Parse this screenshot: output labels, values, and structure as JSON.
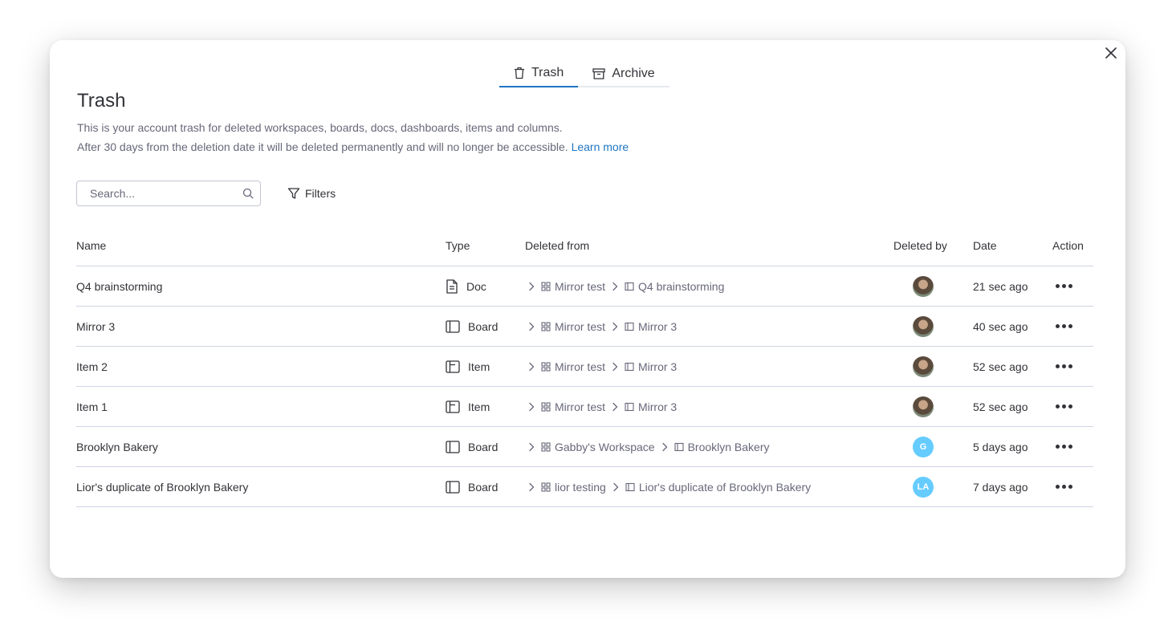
{
  "tabs": [
    {
      "label": "Trash",
      "icon": "trash-icon",
      "active": true
    },
    {
      "label": "Archive",
      "icon": "archive-icon",
      "active": false
    }
  ],
  "title": "Trash",
  "description": {
    "line1": "This is your account trash for deleted workspaces, boards, docs, dashboards, items and columns.",
    "line2": "After 30 days from the deletion date it will be deleted permanently and will no longer be accessible.",
    "link": "Learn more"
  },
  "search": {
    "placeholder": "Search...",
    "value": ""
  },
  "filters_label": "Filters",
  "columns": {
    "name": "Name",
    "type": "Type",
    "deleted_from": "Deleted from",
    "deleted_by": "Deleted by",
    "date": "Date",
    "action": "Action"
  },
  "rows": [
    {
      "name": "Q4 brainstorming",
      "type": "Doc",
      "type_icon": "doc-icon",
      "workspace": "Mirror test",
      "board": "Q4 brainstorming",
      "avatar": "photo",
      "initials": "",
      "date": "21 sec ago"
    },
    {
      "name": "Mirror 3",
      "type": "Board",
      "type_icon": "board-icon",
      "workspace": "Mirror test",
      "board": "Mirror 3",
      "avatar": "photo",
      "initials": "",
      "date": "40 sec ago"
    },
    {
      "name": "Item 2",
      "type": "Item",
      "type_icon": "item-icon",
      "workspace": "Mirror test",
      "board": "Mirror 3",
      "avatar": "photo",
      "initials": "",
      "date": "52 sec ago"
    },
    {
      "name": "Item 1",
      "type": "Item",
      "type_icon": "item-icon",
      "workspace": "Mirror test",
      "board": "Mirror 3",
      "avatar": "photo",
      "initials": "",
      "date": "52 sec ago"
    },
    {
      "name": "Brooklyn Bakery",
      "type": "Board",
      "type_icon": "board-icon",
      "workspace": "Gabby's Workspace",
      "board": "Brooklyn Bakery",
      "avatar": "initials",
      "initials": "G",
      "date": "5 days ago"
    },
    {
      "name": "Lior's duplicate of Brooklyn Bakery",
      "type": "Board",
      "type_icon": "board-icon",
      "workspace": "lior testing",
      "board": "Lior's duplicate of Brooklyn Bakery",
      "avatar": "initials",
      "initials": "LA",
      "date": "7 days ago"
    }
  ],
  "colors": {
    "accent": "#1f76c2",
    "text": "#323338",
    "secondary": "#676879",
    "avatar_initials_bg": "#66ccff",
    "divider": "#d0d4e4"
  }
}
